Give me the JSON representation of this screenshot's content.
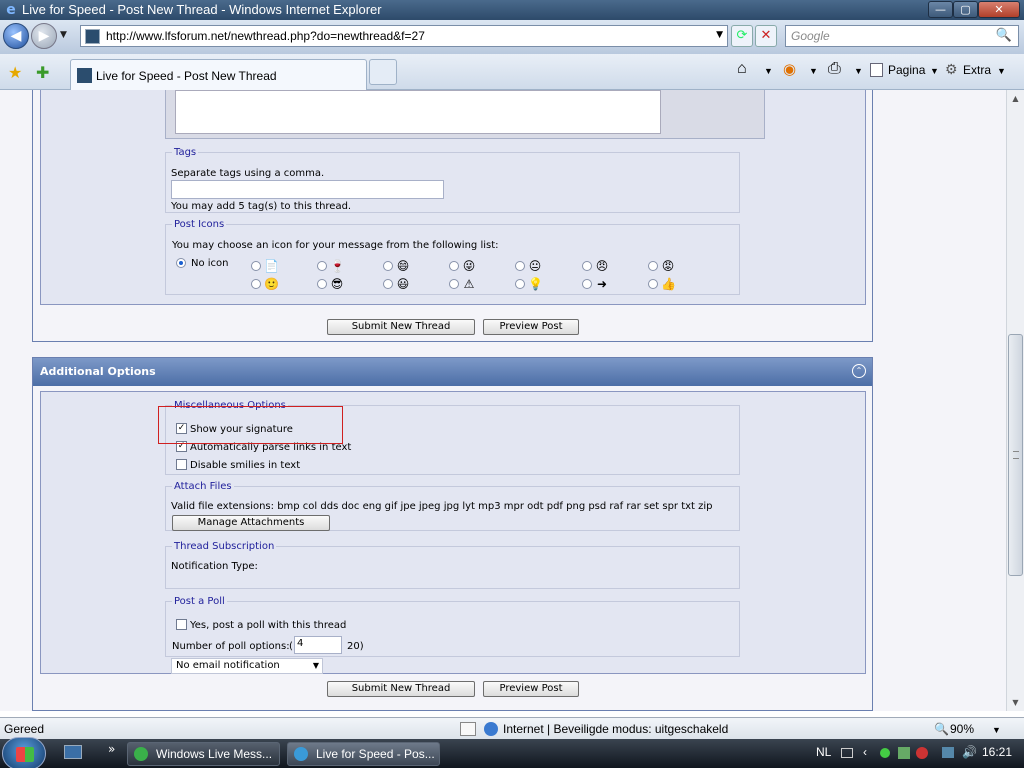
{
  "window": {
    "title": "Live for Speed - Post New Thread - Windows Internet Explorer",
    "min": "—",
    "max": "▢",
    "close": "✕"
  },
  "nav": {
    "back": "◀",
    "forward": "▶",
    "dropdown": "▼",
    "url": "http://www.lfsforum.net/newthread.php?do=newthread&f=27",
    "refresh": "⟳",
    "stop": "✕",
    "search_placeholder": "Google",
    "search_icon": "🔍"
  },
  "tabs": {
    "active": "Live for Speed - Post New Thread"
  },
  "toolbar": {
    "home": "⌂",
    "feeds": "◉",
    "print": "⎙",
    "page": "Pagina",
    "tools": "Extra",
    "dd": "▼"
  },
  "tags": {
    "legend": "Tags",
    "help": "Separate tags using a comma.",
    "note": "You may add 5 tag(s) to this thread."
  },
  "post_icons": {
    "legend": "Post Icons",
    "help": "You may choose an icon for your message from the following list:",
    "no_icon": "No icon",
    "row1": [
      "📄",
      "🍷",
      "😄",
      "😜",
      "😐",
      "😠",
      "😡"
    ],
    "row2": [
      "🙂",
      "😎",
      "😃",
      "⚠",
      "💡",
      "➜",
      "👍"
    ]
  },
  "buttons": {
    "submit": "Submit New Thread",
    "preview": "Preview Post"
  },
  "additional": {
    "title": "Additional Options",
    "collapse": "⌃"
  },
  "misc": {
    "legend": "Miscellaneous Options",
    "sig": "Show your signature",
    "links": "Automatically parse links in text",
    "smilies": "Disable smilies in text",
    "sig_checked": true,
    "links_checked": true,
    "smilies_checked": false,
    "check": "✓"
  },
  "attach": {
    "legend": "Attach Files",
    "exts": "Valid file extensions: bmp col dds doc eng gif jpe jpeg jpg lyt mp3 mpr odt pdf png psd raf rar set spr txt zip",
    "manage": "Manage Attachments"
  },
  "subscription": {
    "legend": "Thread Subscription",
    "label": "Notification Type:",
    "value": "No email notification",
    "arrow": "▼"
  },
  "poll": {
    "legend": "Post a Poll",
    "yes": "Yes, post a poll with this thread",
    "count_label": "Number of poll options:",
    "paren_open": "(",
    "count_value": "4",
    "paren_close": "20)"
  },
  "status": {
    "left": "Gereed",
    "zone": "Internet | Beveiligde modus: uitgeschakeld",
    "zoom": "90%",
    "zoom_dd": "▼"
  },
  "taskbar": {
    "item1": "Windows Live Mess...",
    "item2": "Live for Speed - Pos...",
    "lang": "NL",
    "time": "16:21",
    "chevron": "»"
  }
}
